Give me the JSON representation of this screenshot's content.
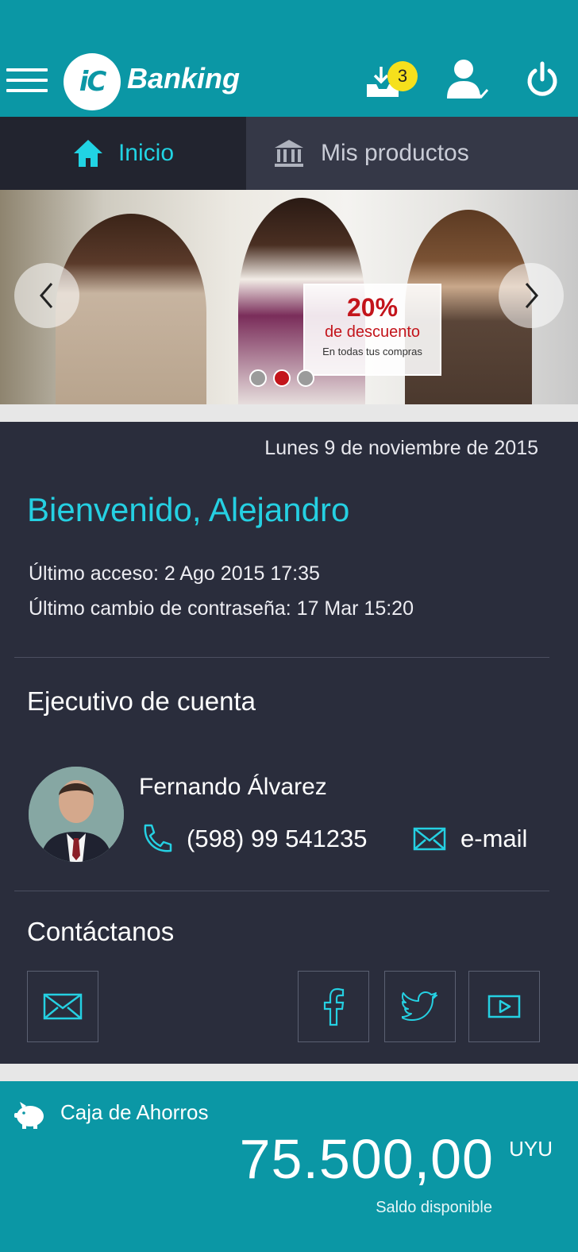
{
  "header": {
    "logo_text": "iC",
    "brand": "Banking",
    "notifications_count": "3"
  },
  "tabs": {
    "home_label": "Inicio",
    "products_label": "Mis productos"
  },
  "banner": {
    "promo_percent": "20%",
    "promo_text": "de descuento",
    "promo_subtext": "En todas tus compras",
    "slides": 3,
    "active_slide": 2
  },
  "welcome": {
    "date": "Lunes 9 de noviembre de 2015",
    "greeting": "Bienvenido, Alejandro",
    "last_access": "Último acceso: 2 Ago 2015 17:35",
    "last_password_change": "Último cambio de contraseña: 17 Mar 15:20"
  },
  "executive": {
    "title": "Ejecutivo de cuenta",
    "name": "Fernando Álvarez",
    "phone": "(598) 99 541235",
    "email_label": "e-mail"
  },
  "contact": {
    "title": "Contáctanos"
  },
  "account": {
    "name": "Caja de Ahorros",
    "amount": "75.500,00",
    "currency": "UYU",
    "label": "Saldo disponible"
  },
  "colors": {
    "primary": "#0b97a5",
    "accent": "#25d0e2",
    "background": "#2a2d3c",
    "promo_red": "#c3141b",
    "badge_yellow": "#f6e01c"
  }
}
